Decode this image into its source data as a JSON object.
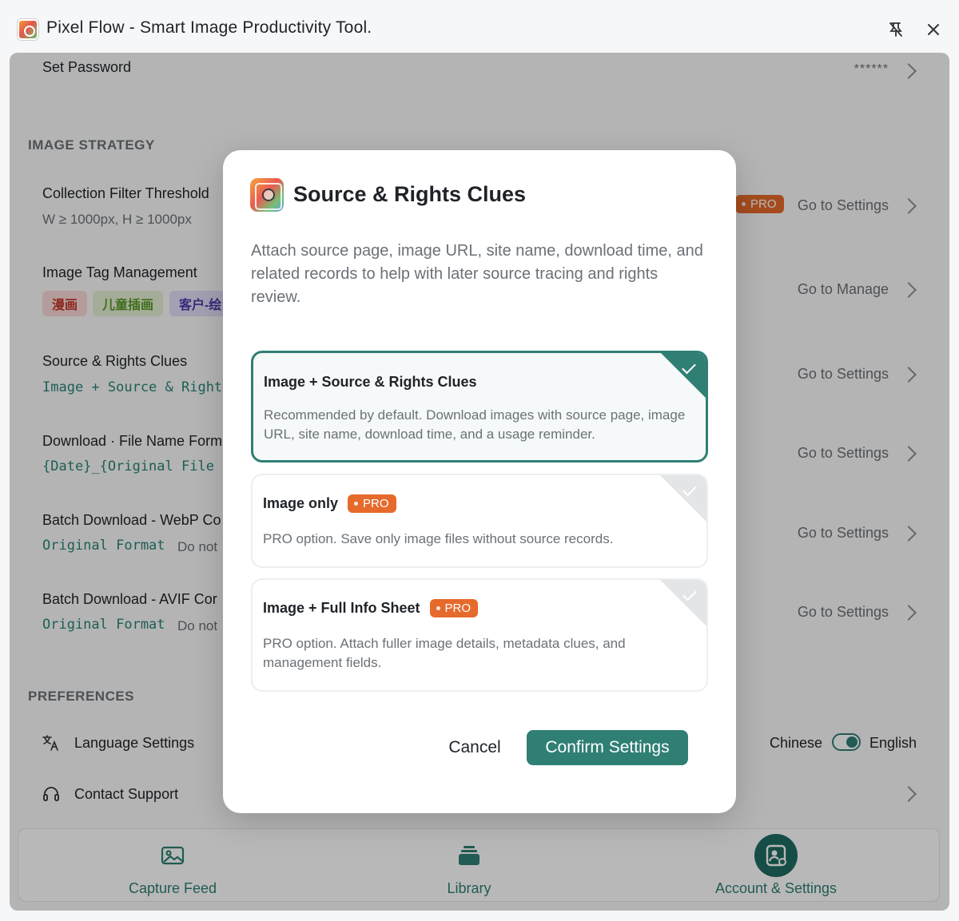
{
  "window": {
    "title": "Pixel Flow - Smart Image Productivity Tool."
  },
  "background": {
    "set_password": {
      "label": "Set Password",
      "value": "******"
    },
    "image_strategy": {
      "section_label": "IMAGE STRATEGY",
      "collection_filter": {
        "label": "Collection Filter Threshold",
        "value": "W ≥ 1000px, H ≥ 1000px",
        "pro_label": "PRO",
        "action": "Go to Settings"
      },
      "tag_management": {
        "label": "Image Tag Management",
        "tags": [
          "漫画",
          "儿童插画",
          "客户-绘"
        ],
        "action": "Go to Manage"
      },
      "source_rights": {
        "label": "Source & Rights Clues",
        "value": "Image + Source & Right",
        "action": "Go to Settings"
      },
      "file_name_format": {
        "label": "Download · File Name Form",
        "value": "{Date}_{Original File",
        "action": "Go to Settings"
      },
      "webp": {
        "label": "Batch Download - WebP Co",
        "value": "Original Format",
        "note": "Do not",
        "action": "Go to Settings"
      },
      "avif": {
        "label": "Batch Download - AVIF Cor",
        "value": "Original Format",
        "note": "Do not",
        "action": "Go to Settings"
      }
    },
    "preferences": {
      "section_label": "PREFERENCES",
      "language": {
        "label": "Language Settings",
        "left": "Chinese",
        "right": "English"
      },
      "support": {
        "label": "Contact Support"
      }
    },
    "bottom_nav": [
      {
        "label": "Capture Feed"
      },
      {
        "label": "Library"
      },
      {
        "label": "Account & Settings"
      }
    ]
  },
  "modal": {
    "title": "Source & Rights Clues",
    "description": "Attach source page, image URL, site name, download time, and related records to help with later source tracing and rights review.",
    "options": [
      {
        "title": "Image + Source & Rights Clues",
        "description": "Recommended by default. Download images with source page, image URL, site name, download time, and a usage reminder."
      },
      {
        "title": "Image only",
        "pro": "PRO",
        "description": "PRO option. Save only image files without source records."
      },
      {
        "title": "Image + Full Info Sheet",
        "pro": "PRO",
        "description": "PRO option. Attach fuller image details, metadata clues, and management fields."
      }
    ],
    "cancel_label": "Cancel",
    "confirm_label": "Confirm Settings"
  }
}
